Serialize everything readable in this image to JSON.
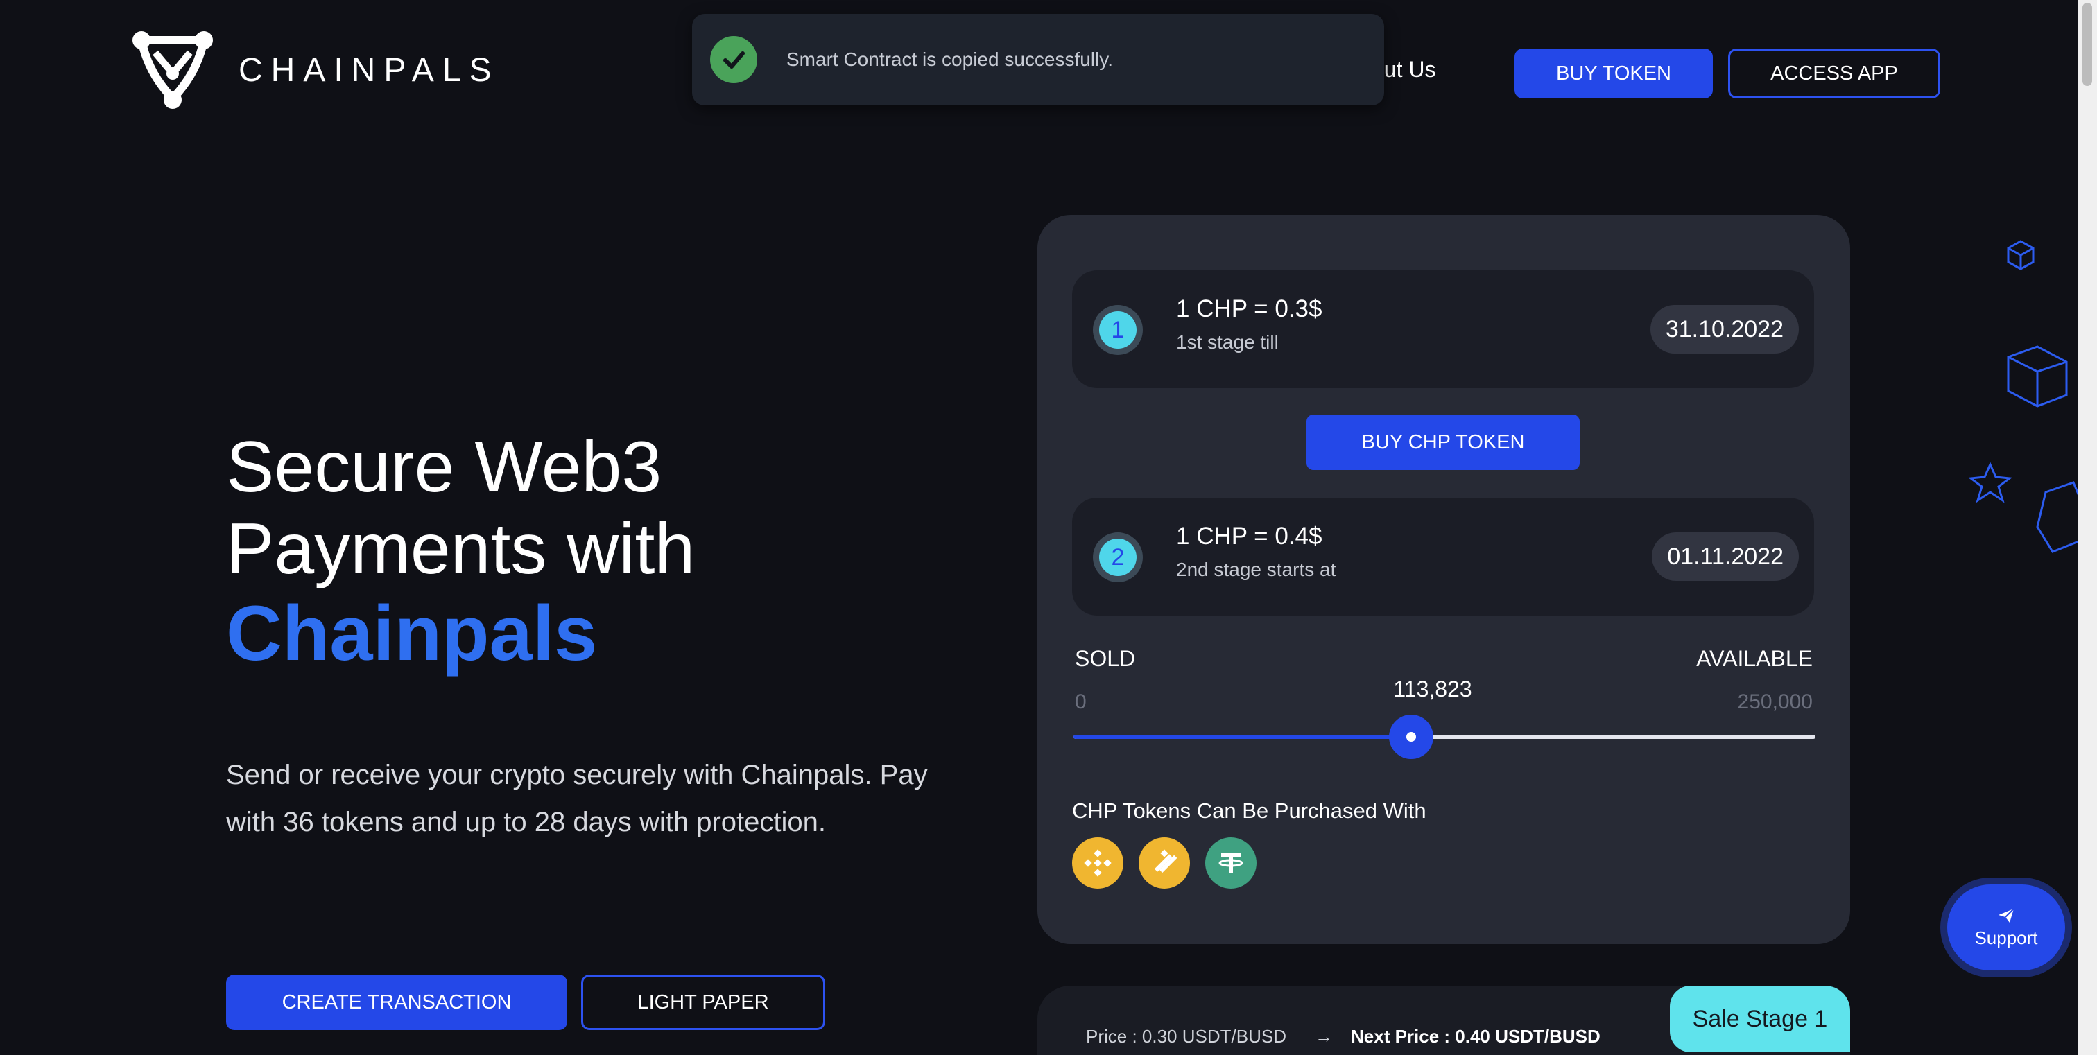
{
  "header": {
    "brand": "CHAINPALS",
    "nav_about": "out Us",
    "buy_token_label": "BUY TOKEN",
    "access_app_label": "ACCESS APP"
  },
  "toast": {
    "message": "Smart Contract is copied successfully."
  },
  "hero": {
    "line1": "Secure Web3",
    "line2": "Payments with",
    "line3": "Chainpals",
    "description": "Send or receive your crypto securely with Chainpals. Pay with 36 tokens and up to 28 days with protection.",
    "create_label": "CREATE TRANSACTION",
    "paper_label": "LIGHT PAPER"
  },
  "sale_card": {
    "stages": [
      {
        "number": "1",
        "price": "1 CHP = 0.3$",
        "subtitle": "1st stage till",
        "date": "31.10.2022"
      },
      {
        "number": "2",
        "price": "1 CHP = 0.4$",
        "subtitle": "2nd stage starts at",
        "date": "01.11.2022"
      }
    ],
    "buy_chp_label": "BUY CHP TOKEN",
    "sold_label": "SOLD",
    "available_label": "AVAILABLE",
    "min_value": "0",
    "max_value": "250,000",
    "current_value": "113,823",
    "progress_percent": 45.5,
    "purchase_label": "CHP Tokens Can Be Purchased With",
    "payment_icons": [
      "bnb-icon",
      "busd-icon",
      "usdt-icon"
    ]
  },
  "bottom_bar": {
    "price_now": "Price : 0.30 USDT/BUSD",
    "arrow": "→",
    "price_next": "Next Price : 0.40 USDT/BUSD",
    "sale_stage": "Sale Stage 1"
  },
  "support": {
    "label": "Support"
  },
  "colors": {
    "accent": "#2448e8",
    "highlight": "#2f6ff0",
    "success": "#4aa35a",
    "stage_tag": "#5fe3ec"
  }
}
